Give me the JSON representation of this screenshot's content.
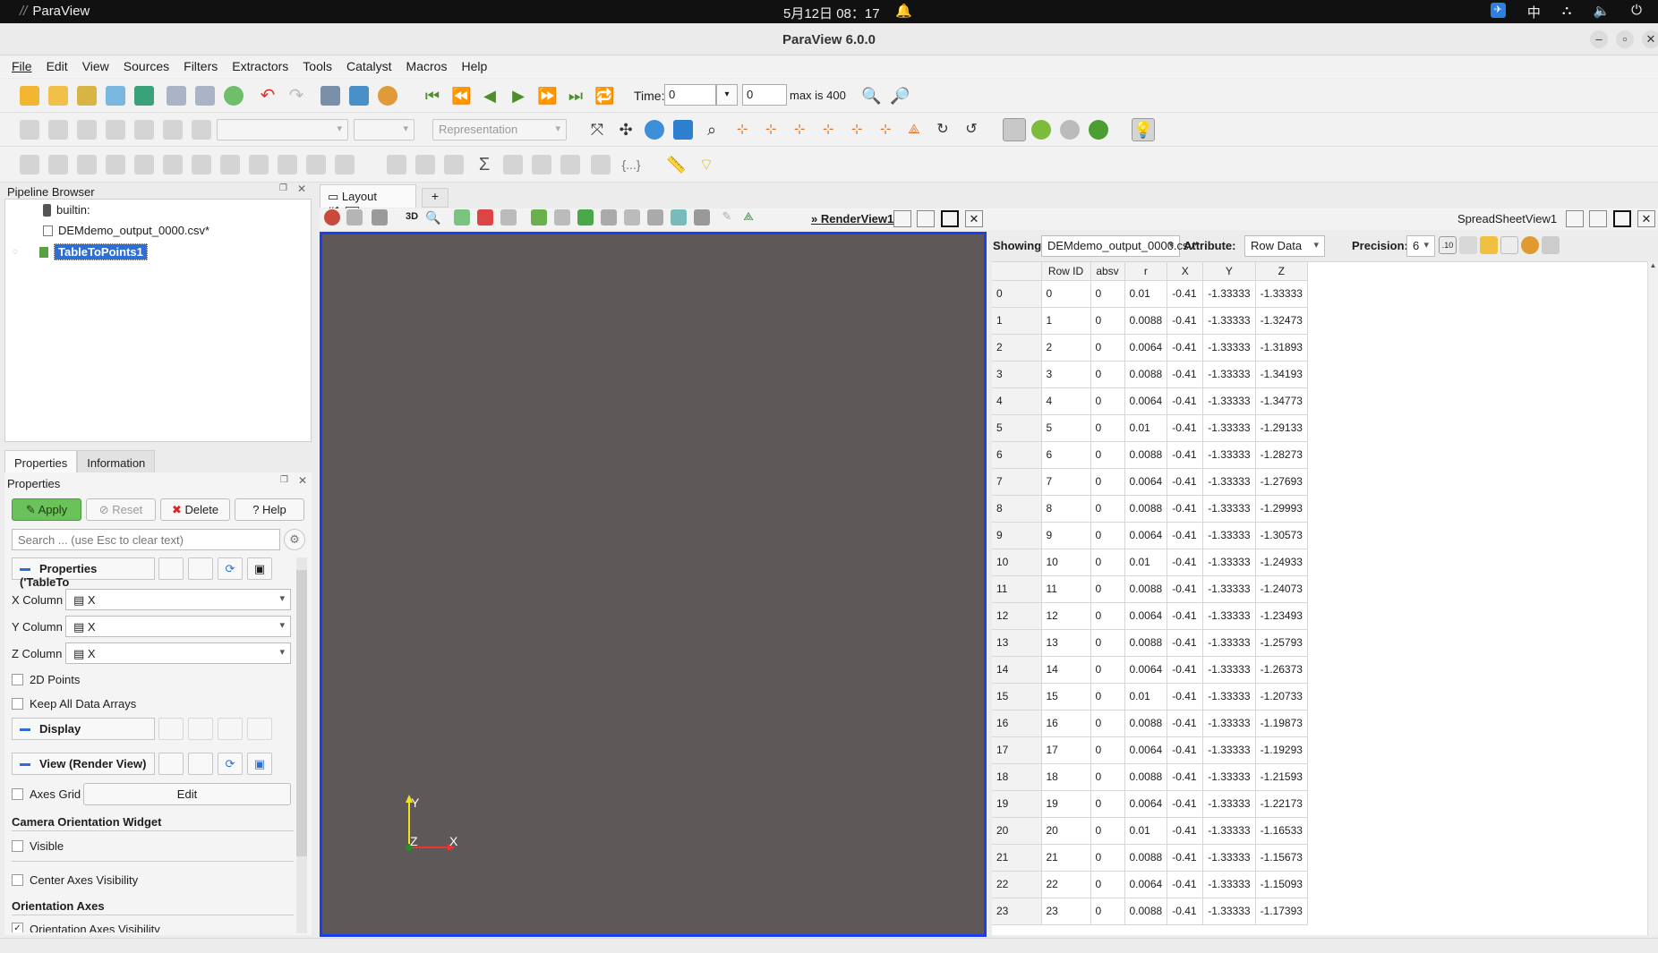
{
  "system": {
    "app_name": "ParaView",
    "clock": "5月12日 08：17",
    "ime": "中",
    "tray_app": "✈"
  },
  "window": {
    "title": "ParaView 6.0.0"
  },
  "menu": [
    "File",
    "Edit",
    "View",
    "Sources",
    "Filters",
    "Extractors",
    "Tools",
    "Catalyst",
    "Macros",
    "Help"
  ],
  "time_toolbar": {
    "label": "Time:",
    "value": "0",
    "step": "0",
    "max_text": "max is 400"
  },
  "representation_placeholder": "Representation",
  "pipeline": {
    "title": "Pipeline Browser",
    "items": [
      {
        "label": "builtin:"
      },
      {
        "label": "DEMdemo_output_0000.csv*"
      },
      {
        "label": "TableToPoints1"
      }
    ]
  },
  "tabs": {
    "properties": "Properties",
    "information": "Information"
  },
  "properties": {
    "title": "Properties",
    "apply": "Apply",
    "reset": "Reset",
    "delete": "Delete",
    "help": "Help",
    "search_placeholder": "Search ... (use Esc to clear text)",
    "section_props": "Properties ('TableTo",
    "x_column_label": "X Column",
    "y_column_label": "Y Column",
    "z_column_label": "Z Column",
    "x_column": "X",
    "y_column": "X",
    "z_column": "X",
    "points_2d": "2D Points",
    "keep_arrays": "Keep All Data Arrays",
    "section_display": "Display",
    "section_view": "View (Render View)",
    "axes_grid": "Axes Grid",
    "edit": "Edit",
    "camera_widget": "Camera Orientation Widget",
    "visible": "Visible",
    "center_axes": "Center Axes Visibility",
    "orientation_axes": "Orientation Axes",
    "orientation_axes_vis": "Orientation Axes Visibility"
  },
  "layout": {
    "tab": "Layout #1",
    "plus": "+",
    "render_view": "RenderView1",
    "spreadsheet_view": "SpreadSheetView1",
    "mode_3d": "3D"
  },
  "axes": {
    "y": "Y",
    "z": "Z",
    "x": "X"
  },
  "spreadsheet": {
    "showing_label": "Showing",
    "showing_value": "DEMdemo_output_0000.csv*",
    "attribute_label": "Attribute:",
    "attribute_value": "Row Data",
    "precision_label": "Precision:",
    "precision_value": "6",
    "columns": [
      "Row ID",
      "absv",
      "r",
      "X",
      "Y",
      "Z"
    ],
    "rows": [
      [
        "0",
        "0",
        "0",
        "0.01",
        "-0.41",
        "-1.33333",
        "-1.33333"
      ],
      [
        "1",
        "1",
        "0",
        "0.0088",
        "-0.41",
        "-1.33333",
        "-1.32473"
      ],
      [
        "2",
        "2",
        "0",
        "0.0064",
        "-0.41",
        "-1.33333",
        "-1.31893"
      ],
      [
        "3",
        "3",
        "0",
        "0.0088",
        "-0.41",
        "-1.33333",
        "-1.34193"
      ],
      [
        "4",
        "4",
        "0",
        "0.0064",
        "-0.41",
        "-1.33333",
        "-1.34773"
      ],
      [
        "5",
        "5",
        "0",
        "0.01",
        "-0.41",
        "-1.33333",
        "-1.29133"
      ],
      [
        "6",
        "6",
        "0",
        "0.0088",
        "-0.41",
        "-1.33333",
        "-1.28273"
      ],
      [
        "7",
        "7",
        "0",
        "0.0064",
        "-0.41",
        "-1.33333",
        "-1.27693"
      ],
      [
        "8",
        "8",
        "0",
        "0.0088",
        "-0.41",
        "-1.33333",
        "-1.29993"
      ],
      [
        "9",
        "9",
        "0",
        "0.0064",
        "-0.41",
        "-1.33333",
        "-1.30573"
      ],
      [
        "10",
        "10",
        "0",
        "0.01",
        "-0.41",
        "-1.33333",
        "-1.24933"
      ],
      [
        "11",
        "11",
        "0",
        "0.0088",
        "-0.41",
        "-1.33333",
        "-1.24073"
      ],
      [
        "12",
        "12",
        "0",
        "0.0064",
        "-0.41",
        "-1.33333",
        "-1.23493"
      ],
      [
        "13",
        "13",
        "0",
        "0.0088",
        "-0.41",
        "-1.33333",
        "-1.25793"
      ],
      [
        "14",
        "14",
        "0",
        "0.0064",
        "-0.41",
        "-1.33333",
        "-1.26373"
      ],
      [
        "15",
        "15",
        "0",
        "0.01",
        "-0.41",
        "-1.33333",
        "-1.20733"
      ],
      [
        "16",
        "16",
        "0",
        "0.0088",
        "-0.41",
        "-1.33333",
        "-1.19873"
      ],
      [
        "17",
        "17",
        "0",
        "0.0064",
        "-0.41",
        "-1.33333",
        "-1.19293"
      ],
      [
        "18",
        "18",
        "0",
        "0.0088",
        "-0.41",
        "-1.33333",
        "-1.21593"
      ],
      [
        "19",
        "19",
        "0",
        "0.0064",
        "-0.41",
        "-1.33333",
        "-1.22173"
      ],
      [
        "20",
        "20",
        "0",
        "0.01",
        "-0.41",
        "-1.33333",
        "-1.16533"
      ],
      [
        "21",
        "21",
        "0",
        "0.0088",
        "-0.41",
        "-1.33333",
        "-1.15673"
      ],
      [
        "22",
        "22",
        "0",
        "0.0064",
        "-0.41",
        "-1.33333",
        "-1.15093"
      ],
      [
        "23",
        "23",
        "0",
        "0.0088",
        "-0.41",
        "-1.33333",
        "-1.17393"
      ]
    ]
  }
}
